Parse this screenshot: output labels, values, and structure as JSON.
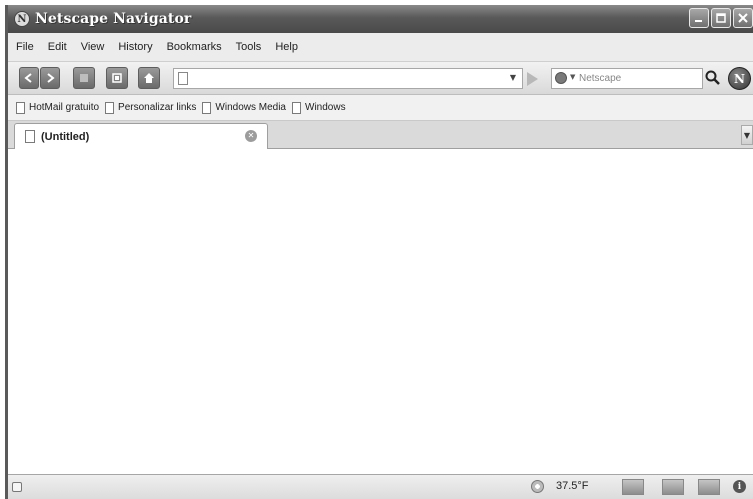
{
  "window": {
    "title": "Netscape Navigator",
    "logo_letter": "N",
    "buttons": [
      "minimize",
      "maximize",
      "close"
    ]
  },
  "menu": {
    "items": [
      "File",
      "Edit",
      "View",
      "History",
      "Bookmarks",
      "Tools",
      "Help"
    ]
  },
  "toolbar": {
    "url_value": "",
    "search_placeholder": "Netscape",
    "icons": [
      "back-icon",
      "forward-icon",
      "stop-icon",
      "reload-icon",
      "home-icon",
      "go-icon",
      "search-engine-icon",
      "magnifier-icon",
      "netscape-logo-icon"
    ]
  },
  "bookmarks": {
    "items": [
      "HotMail gratuito",
      "Personalizar links",
      "Windows Media",
      "Windows"
    ]
  },
  "tabs": [
    {
      "label": "(Untitled)",
      "active": true
    }
  ],
  "status": {
    "temperature": "37.5°F"
  },
  "colors": {
    "titlebar": "#595959",
    "toolbar_button": "#7a7a7a",
    "content_bg": "#ffffff"
  }
}
